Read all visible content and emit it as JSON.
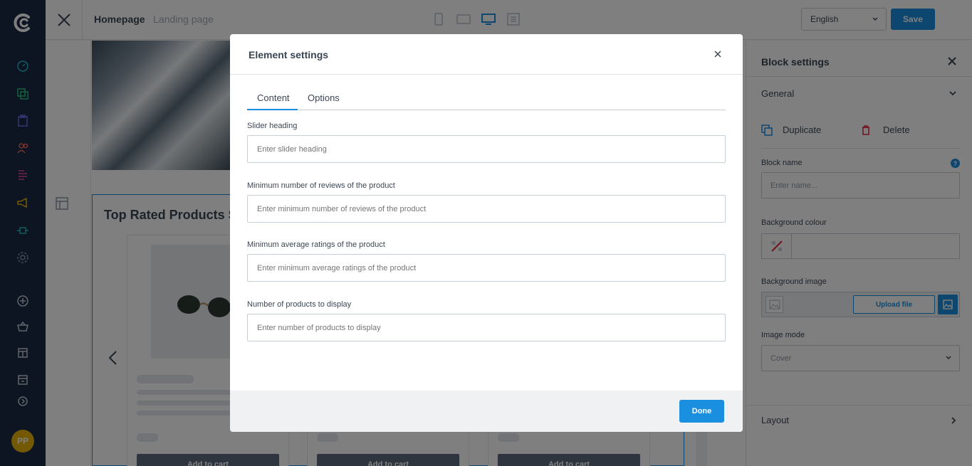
{
  "topbar": {
    "page_name": "Homepage",
    "page_type": "Landing page",
    "language": "English",
    "save_label": "Save"
  },
  "user": {
    "initials": "PP"
  },
  "canvas": {
    "products_title": "Top Rated Products Sl",
    "add_to_cart": "Add to cart"
  },
  "block_settings": {
    "title": "Block settings",
    "general": "General",
    "duplicate": "Duplicate",
    "delete": "Delete",
    "block_name_label": "Block name",
    "block_name_placeholder": "Enter name...",
    "help_mark": "?",
    "bg_colour_label": "Background colour",
    "bg_image_label": "Background image",
    "upload_label": "Upload file",
    "image_mode_label": "Image mode",
    "image_mode_value": "Cover",
    "layout": "Layout"
  },
  "modal": {
    "title": "Element settings",
    "tabs": {
      "content": "Content",
      "options": "Options"
    },
    "fields": [
      {
        "label": "Slider heading",
        "placeholder": "Enter slider heading"
      },
      {
        "label": "Minimum number of reviews of the product",
        "placeholder": "Enter minimum number of reviews of the product"
      },
      {
        "label": "Minimum average ratings of the product",
        "placeholder": "Enter minimum average ratings of the product"
      },
      {
        "label": "Number of products to display",
        "placeholder": "Enter number of products to display"
      }
    ],
    "done_label": "Done"
  },
  "colors": {
    "accent": "#1a8fe0",
    "nav_bg": "#1b2b44",
    "avatar": "#e8b20a",
    "delete": "#e0283a"
  }
}
